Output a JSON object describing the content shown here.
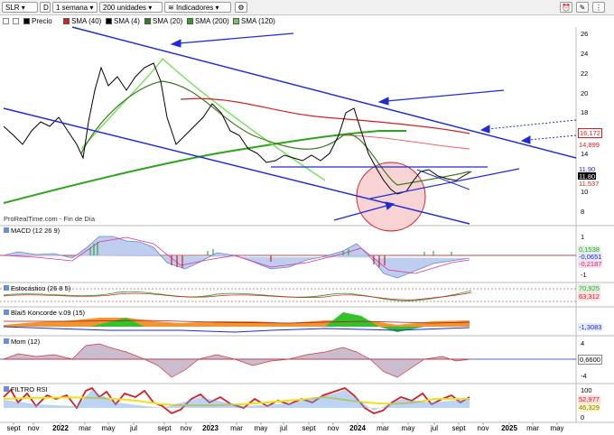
{
  "toolbar": {
    "symbol": "SLR",
    "period_letter": "D",
    "timeframe": "1 semana",
    "units": "200 unidades",
    "indicators": "Indicadores"
  },
  "legend": {
    "price": "Precio",
    "sma40": "SMA (40)",
    "sma4": "SMA (4)",
    "sma20": "SMA (20)",
    "sma200": "SMA (200)",
    "sma120": "SMA (120)"
  },
  "source_label": "ProRealTime.com - Fin de Día",
  "panels": {
    "macd": "MACD (12 26 9)",
    "stoch": "Estocástico (26 8 5)",
    "blai5": "Blai5 Koncorde v.09 (15)",
    "mom": "Mom (12)",
    "rsi": "FILTRO RSI"
  },
  "y_axis": {
    "main": [
      "26",
      "24",
      "22",
      "20",
      "18",
      "16",
      "14",
      "12",
      "10",
      "8"
    ],
    "macd": [
      "1",
      "0",
      "-1"
    ],
    "stoch": [
      "100",
      "0"
    ],
    "mom": [
      "4",
      "0",
      "-4"
    ],
    "rsi": [
      "100",
      "0"
    ]
  },
  "price_tags": {
    "p1": "16,172",
    "p2": "14,899",
    "p3": "11,90",
    "p4": "11,80",
    "p5": "11,537"
  },
  "indicator_tags": {
    "macd1": "0,1538",
    "macd2": "-0,0651",
    "macd3": "-0,2187",
    "stoch1": "70,925",
    "stoch2": "63,312",
    "blai": "-1,3083",
    "mom": "0,6600",
    "rsi1": "52,977",
    "rsi2": "46,329"
  },
  "x_axis": [
    "sept",
    "nov",
    "2022",
    "mar",
    "may",
    "jul",
    "sept",
    "nov",
    "2023",
    "mar",
    "may",
    "jul",
    "sept",
    "nov",
    "2024",
    "mar",
    "may",
    "jul",
    "sept",
    "nov",
    "2025",
    "mar",
    "may"
  ],
  "colors": {
    "trendline": "#1f2bd6",
    "sma20": "#3b7a1e",
    "sma200": "#2ea31c",
    "sma40": "#d42020",
    "circle": "#f1b7b7"
  }
}
